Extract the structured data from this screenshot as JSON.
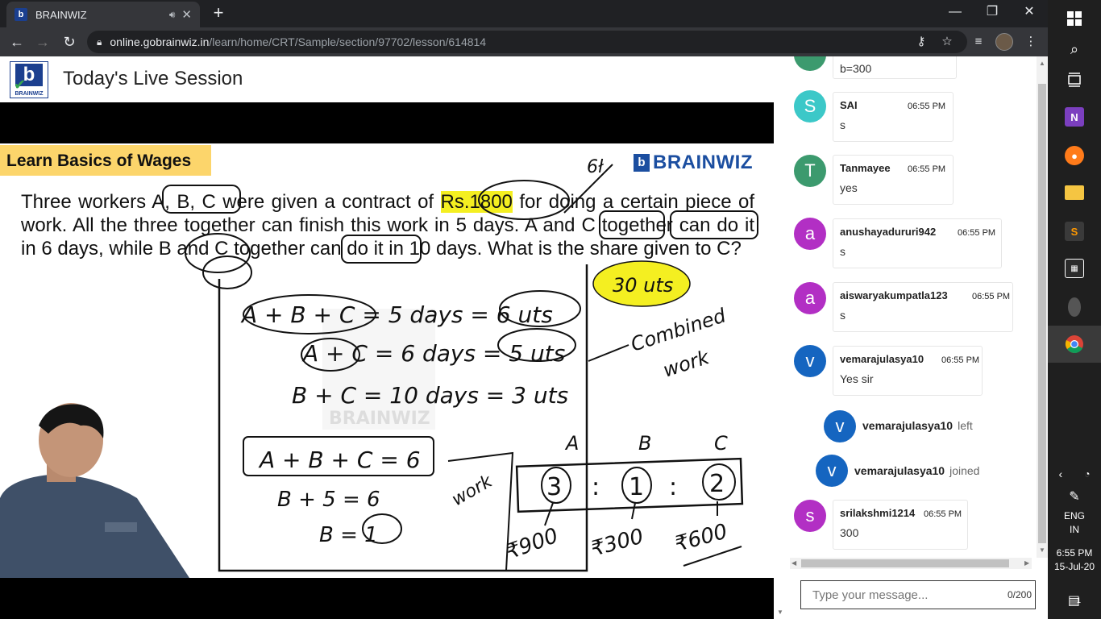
{
  "browser": {
    "tab_title": "BRAINWIZ",
    "favicon_letter": "b",
    "new_tab": "+",
    "url_host": "online.gobrainwiz.in",
    "url_path": "/learn/home/CRT/Sample/section/97702/lesson/614814"
  },
  "site": {
    "logo_text": "BRAINWIZ",
    "logo_letter": "b",
    "page_title": "Today's Live Session"
  },
  "slide": {
    "topic": "Learn Basics of Wages",
    "brand": "BRAINWIZ",
    "brand_letter": "b",
    "question_parts": {
      "p1": "Three workers A, B, C were given a contract of ",
      "amount": "Rs.1800",
      "p2": " for doing a certain piece of work. All the three together can finish this work in 5 days. A and C together can do it in 6 days, while B and C together can do it in 10 days. What is the share given to C?"
    },
    "handwriting": {
      "annot_61": "6ł",
      "units_total": "30 uts",
      "line1": "A + B + C = 5 days = 6 uts",
      "line2": "A + C = 6 days = 5 uts",
      "line3": "B + C = 10 days = 3 uts",
      "combined": "Combined",
      "work_label": "work",
      "box_eq": "A + B + C = 6",
      "eq_b1": "B + 5 = 6",
      "eq_b2": "B = 1",
      "work_left": "work",
      "hdr_a": "A",
      "hdr_b": "B",
      "hdr_c": "C",
      "ratio_a": "3",
      "ratio_b": "1",
      "ratio_c": "2",
      "colon": ":",
      "share_a": "₹900",
      "share_b": "₹300",
      "share_c": "₹600",
      "watermark": "BRAINWIZ"
    }
  },
  "chat": {
    "partial_text": "b=300",
    "messages": [
      {
        "initial": "S",
        "color": "#3cc8c8",
        "name": "SAI",
        "time": "06:55 PM",
        "text": "s"
      },
      {
        "initial": "T",
        "color": "#3c9a6e",
        "name": "Tanmayee",
        "time": "06:55 PM",
        "text": "yes"
      },
      {
        "initial": "a",
        "color": "#b22fc4",
        "name": "anushayadururi942",
        "time": "06:55 PM",
        "text": "s"
      },
      {
        "initial": "a",
        "color": "#b22fc4",
        "name": "aiswaryakumpatla123",
        "time": "06:55 PM",
        "text": "s"
      },
      {
        "initial": "v",
        "color": "#1565c0",
        "name": "vemarajulasya10",
        "time": "06:55 PM",
        "text": "Yes sir"
      },
      {
        "initial": "s",
        "color": "#b22fc4",
        "name": "srilakshmi1214",
        "time": "06:55 PM",
        "text": "300"
      }
    ],
    "system": [
      {
        "initial": "v",
        "name": "vemarajulasya10",
        "action": "left"
      },
      {
        "initial": "v",
        "name": "vemarajulasya10",
        "action": "joined"
      }
    ],
    "input_placeholder": "Type your message...",
    "char_count": "0/200"
  },
  "taskbar": {
    "lang_top": "ENG",
    "lang_bottom": "IN",
    "time": "6:55 PM",
    "date": "15-Jul-20",
    "notifications": "1",
    "apps": [
      "start-icon",
      "search-icon",
      "task-view-icon",
      "onenote-icon",
      "firefox-icon",
      "file-explorer-icon",
      "sublime-icon",
      "calculator-icon",
      "webcam-icon",
      "chrome-icon"
    ]
  }
}
